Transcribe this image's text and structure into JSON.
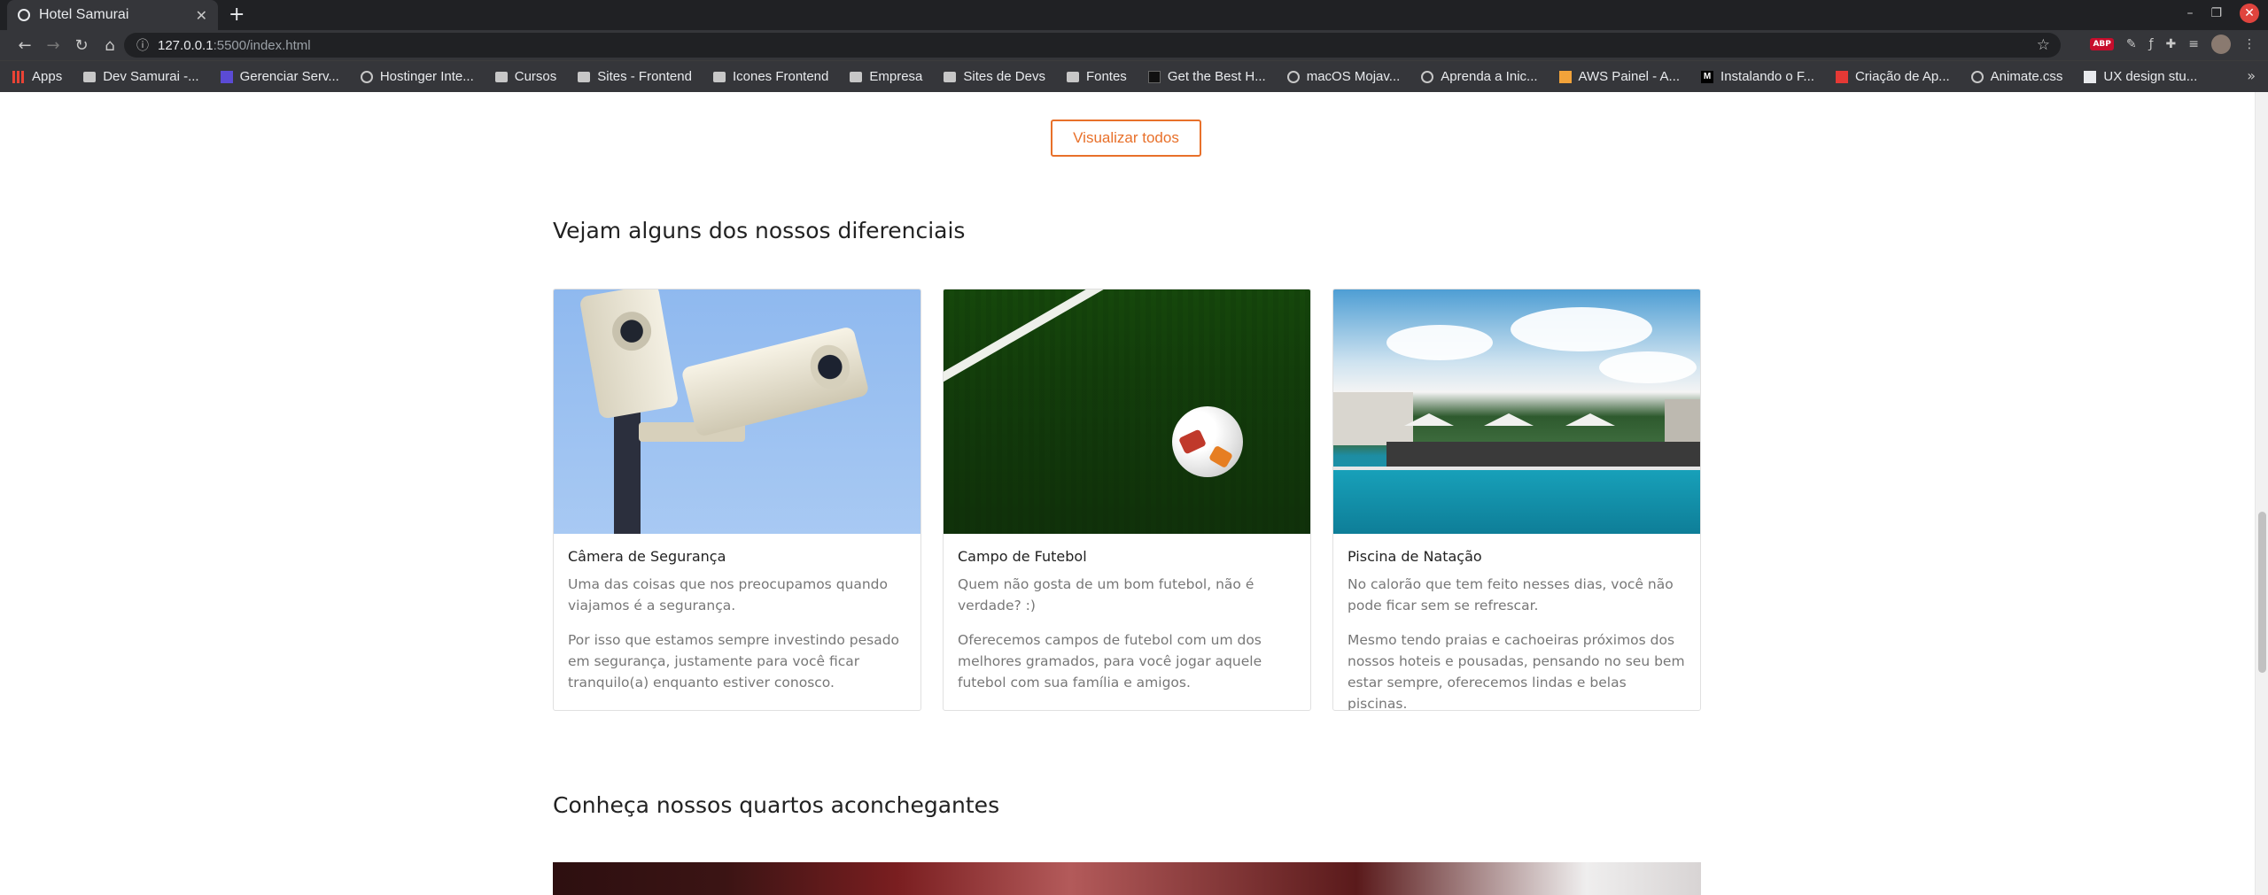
{
  "browser": {
    "tab_title": "Hotel Samurai",
    "url_host": "127.0.0.1",
    "url_path": ":5500/index.html",
    "bookmarks": [
      {
        "label": "Apps",
        "icon": "apps"
      },
      {
        "label": "Dev Samurai -...",
        "icon": "folder"
      },
      {
        "label": "Gerenciar Serv...",
        "icon": "sq"
      },
      {
        "label": "Hostinger Inte...",
        "icon": "globe"
      },
      {
        "label": "Cursos",
        "icon": "folder"
      },
      {
        "label": "Sites - Frontend",
        "icon": "folder"
      },
      {
        "label": "Icones Frontend",
        "icon": "folder"
      },
      {
        "label": "Empresa",
        "icon": "folder"
      },
      {
        "label": "Sites de Devs",
        "icon": "folder"
      },
      {
        "label": "Fontes",
        "icon": "folder"
      },
      {
        "label": "Get the Best H...",
        "icon": "black"
      },
      {
        "label": "macOS Mojav...",
        "icon": "globe"
      },
      {
        "label": "Aprenda a Inic...",
        "icon": "globe"
      },
      {
        "label": "AWS Painel - A...",
        "icon": "orange"
      },
      {
        "label": "Instalando o F...",
        "icon": "mblk"
      },
      {
        "label": "Criação de Ap...",
        "icon": "red"
      },
      {
        "label": "Animate.css",
        "icon": "globe"
      },
      {
        "label": "UX design stu...",
        "icon": "white"
      }
    ]
  },
  "main": {
    "view_all_label": "Visualizar todos",
    "features_title": "Vejam alguns dos nossos diferenciais",
    "features": [
      {
        "title": "Câmera de Segurança",
        "p1": "Uma das coisas que nos preocupamos quando viajamos é a segurança.",
        "p2": "Por isso que estamos sempre investindo pesado em segurança, justamente para você ficar tranquilo(a) enquanto estiver conosco."
      },
      {
        "title": "Campo de Futebol",
        "p1": "Quem não gosta de um bom futebol, não é verdade? :)",
        "p2": "Oferecemos campos de futebol com um dos melhores gramados, para você jogar aquele futebol com sua família e amigos."
      },
      {
        "title": "Piscina de Natação",
        "p1": "No calorão que tem feito nesses dias, você não pode ficar sem se refrescar.",
        "p2": "Mesmo tendo praias e cachoeiras próximos dos nossos hoteis e pousadas, pensando no seu bem estar sempre, oferecemos lindas e belas piscinas."
      }
    ],
    "rooms_title": "Conheça nossos quartos aconchegantes"
  },
  "colors": {
    "accent": "#e8702a",
    "text_dark": "#222222",
    "text_muted": "#777777"
  }
}
